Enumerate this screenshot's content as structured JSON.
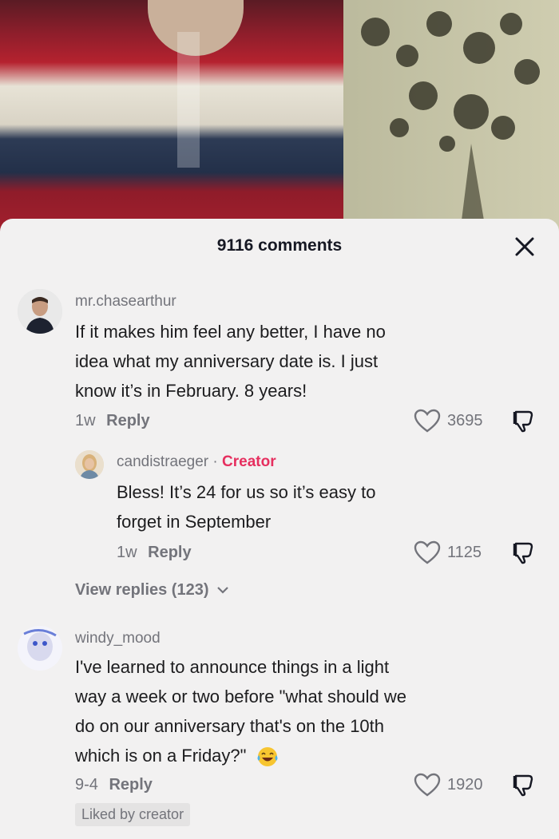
{
  "header": {
    "count": "9116 comments"
  },
  "comments": [
    {
      "username": "mr.chasearthur",
      "text_lines": [
        "If it makes him feel any better, I have no",
        "idea what my anniversary date is. I just",
        "know it’s in February. 8 years!"
      ],
      "time": "1w",
      "reply_label": "Reply",
      "likes": "3695"
    },
    {
      "username": "candistraeger",
      "creator_badge": "Creator",
      "separator": "·",
      "text_lines": [
        "Bless! It’s 24 for us so it’s easy to",
        "forget in September"
      ],
      "time": "1w",
      "reply_label": "Reply",
      "likes": "1125"
    },
    {
      "username": "windy_mood",
      "text_lines": [
        "I've learned to announce things in a light",
        "way a week or two before \"what should we",
        "do on our anniversary that's on the 10th",
        "which is on a Friday?\""
      ],
      "emoji": "laughing-tears-emoji",
      "time": "9-4",
      "reply_label": "Reply",
      "likes": "1920",
      "liked_by": "Liked by creator"
    }
  ],
  "view_replies": "View replies (123)",
  "colors": {
    "creator_accent": "#e62f5f",
    "muted": "#73747b",
    "panel": "#f2f1f1"
  }
}
